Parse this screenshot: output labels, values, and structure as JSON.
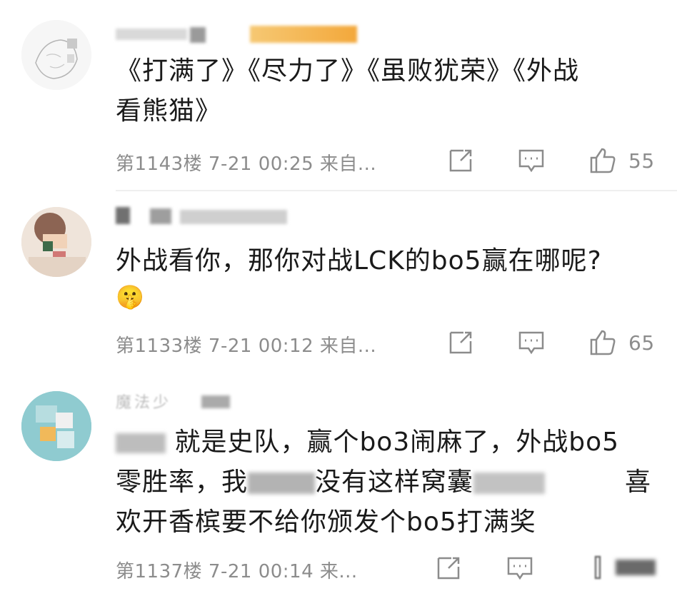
{
  "comments": [
    {
      "text_line1": "《打满了》《尽力了》《虽败犹荣》《外战",
      "text_line2": "看熊猫》",
      "floor_info": "第1143楼  7-21 00:25  来自...",
      "likes": "55"
    },
    {
      "text_line1": "外战看你，那你对战LCK的bo5赢在哪呢?",
      "emoji": "🤫",
      "floor_info": "第1133楼  7-21 00:12  来自...",
      "likes": "65"
    },
    {
      "username_partial": "魔法少",
      "text_line1_a": "就是史队，赢个bo3闹麻了，外战bo5",
      "text_line2_a": "零胜率，我",
      "text_line2_b": "没有这样窝囊",
      "text_line2_c": "喜",
      "text_line3": "欢开香槟要不给你颁发个bo5打满奖",
      "floor_info": "第1137楼  7-21 00:14  来..."
    }
  ],
  "icons": {
    "share": "share-icon",
    "reply": "comment-icon",
    "like": "thumbs-up-icon"
  },
  "colors": {
    "meta_gray": "#8c8c8c",
    "text": "#1a1a1a",
    "divider": "#efefef"
  }
}
